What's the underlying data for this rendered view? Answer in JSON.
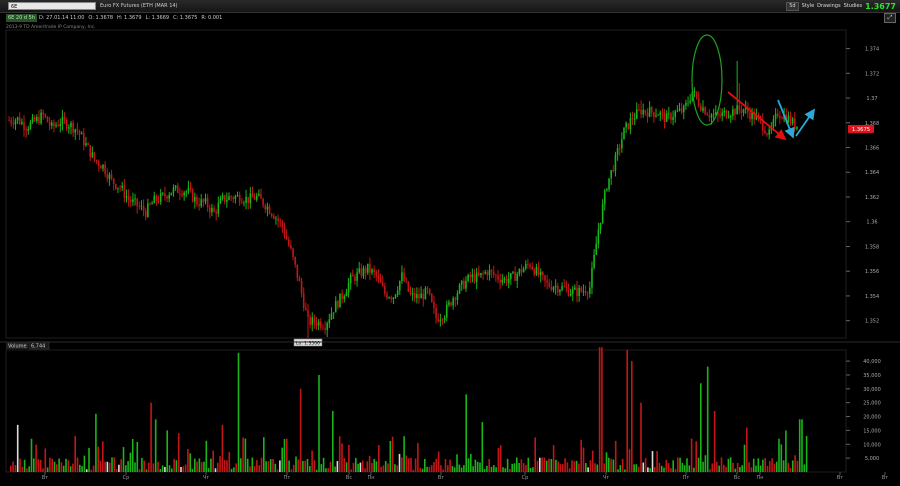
{
  "toolbar": {
    "symbol": "6E",
    "description": "Euro FX Futures (ETH (MAR 14)",
    "timeframe": "5d",
    "style_label": "Style",
    "drawings_label": "Drawings",
    "studies_label": "Studies",
    "last_price": "1.3677"
  },
  "quote": {
    "symbol_tag": "6E 20 d 5h",
    "date": "D: 27.01.14 11:00",
    "open": "O: 1.3678",
    "high": "H: 1.3679",
    "low": "L: 1.3669",
    "close": "C: 1.3675",
    "range": "R: 0.001"
  },
  "copyright": "2013-9 TD Ameritrade IP Company, Inc.",
  "colors": {
    "up": "#19b519",
    "down": "#c41616",
    "accent_green": "#2ee02e",
    "price_tag": "#e0141e",
    "annotation_red": "#e01010",
    "annotation_blue": "#2aa8d8",
    "ellipse": "#1fa31f"
  },
  "chart_data": [
    {
      "type": "candlestick",
      "title": "",
      "y_axis_ticks": [
        1.352,
        1.354,
        1.356,
        1.358,
        1.36,
        1.362,
        1.364,
        1.366,
        1.368,
        1.37,
        1.372,
        1.374
      ],
      "y_axis_tick_labels": [
        "1.352",
        "1.354",
        "1.356",
        "1.358",
        "1.36",
        "1.362",
        "1.364",
        "1.366",
        "1.368",
        "1.37",
        "1.372",
        "1.374"
      ],
      "ylim": [
        1.3506,
        1.3755
      ],
      "x_axis_labels": [
        "Вт",
        "Ср",
        "Чт",
        "Пт",
        "Вс",
        "Пн",
        "Вт",
        "Ср",
        "Чт",
        "Пт",
        "Вс",
        "Пн",
        "Вт",
        "Вт"
      ],
      "last_price_label": "1.3675",
      "low_annotation": "Lo: 1.3506",
      "close_path": [
        [
          0,
          1.3682
        ],
        [
          4,
          1.3683
        ],
        [
          8,
          1.3677
        ],
        [
          12,
          1.3681
        ],
        [
          16,
          1.3686
        ],
        [
          20,
          1.3676
        ],
        [
          24,
          1.3681
        ],
        [
          28,
          1.3679
        ],
        [
          32,
          1.3674
        ],
        [
          36,
          1.3662
        ],
        [
          40,
          1.365
        ],
        [
          44,
          1.3645
        ],
        [
          48,
          1.3633
        ],
        [
          52,
          1.3628
        ],
        [
          56,
          1.3618
        ],
        [
          60,
          1.3613
        ],
        [
          64,
          1.3608
        ],
        [
          68,
          1.3617
        ],
        [
          72,
          1.362
        ],
        [
          76,
          1.3625
        ],
        [
          80,
          1.3626
        ],
        [
          84,
          1.3624
        ],
        [
          88,
          1.3616
        ],
        [
          92,
          1.3615
        ],
        [
          96,
          1.3607
        ],
        [
          100,
          1.3618
        ],
        [
          104,
          1.362
        ],
        [
          108,
          1.362
        ],
        [
          112,
          1.3618
        ],
        [
          116,
          1.362
        ],
        [
          120,
          1.3614
        ],
        [
          124,
          1.3606
        ],
        [
          128,
          1.3596
        ],
        [
          132,
          1.3576
        ],
        [
          136,
          1.355
        ],
        [
          140,
          1.3519
        ],
        [
          144,
          1.3519
        ],
        [
          148,
          1.3517
        ],
        [
          152,
          1.353
        ],
        [
          156,
          1.354
        ],
        [
          160,
          1.3553
        ],
        [
          164,
          1.3558
        ],
        [
          168,
          1.3562
        ],
        [
          172,
          1.3556
        ],
        [
          176,
          1.3542
        ],
        [
          180,
          1.354
        ],
        [
          184,
          1.3556
        ],
        [
          188,
          1.354
        ],
        [
          192,
          1.3539
        ],
        [
          196,
          1.3543
        ],
        [
          200,
          1.3522
        ],
        [
          204,
          1.3526
        ],
        [
          208,
          1.3539
        ],
        [
          212,
          1.3548
        ],
        [
          216,
          1.3555
        ],
        [
          220,
          1.3555
        ],
        [
          224,
          1.356
        ],
        [
          228,
          1.3556
        ],
        [
          232,
          1.3553
        ],
        [
          236,
          1.3555
        ],
        [
          240,
          1.3561
        ],
        [
          244,
          1.3566
        ],
        [
          248,
          1.3557
        ],
        [
          252,
          1.3549
        ],
        [
          256,
          1.3548
        ],
        [
          260,
          1.3546
        ],
        [
          264,
          1.3543
        ],
        [
          268,
          1.3544
        ],
        [
          272,
          1.3547
        ],
        [
          276,
          1.3594
        ],
        [
          280,
          1.363
        ],
        [
          284,
          1.365
        ],
        [
          288,
          1.3673
        ],
        [
          292,
          1.3684
        ],
        [
          296,
          1.369
        ],
        [
          300,
          1.3689
        ],
        [
          304,
          1.3688
        ],
        [
          308,
          1.3683
        ],
        [
          312,
          1.3688
        ],
        [
          316,
          1.369
        ],
        [
          320,
          1.3705
        ],
        [
          324,
          1.3694
        ],
        [
          328,
          1.3687
        ],
        [
          332,
          1.3685
        ],
        [
          336,
          1.3688
        ],
        [
          340,
          1.369
        ],
        [
          344,
          1.3691
        ],
        [
          348,
          1.3686
        ],
        [
          352,
          1.3681
        ],
        [
          356,
          1.367
        ],
        [
          360,
          1.3688
        ],
        [
          364,
          1.3685
        ],
        [
          368,
          1.3678
        ]
      ]
    },
    {
      "type": "bar",
      "title": "Volume",
      "value_label": "6,744",
      "y_axis_ticks": [
        5000,
        10000,
        15000,
        20000,
        25000,
        30000,
        35000,
        40000
      ],
      "y_axis_tick_labels": [
        "5,000",
        "10,000",
        "15,000",
        "20,000",
        "25,000",
        "30,000",
        "35,000",
        "40,000"
      ],
      "ylim": [
        0,
        44000
      ]
    }
  ]
}
